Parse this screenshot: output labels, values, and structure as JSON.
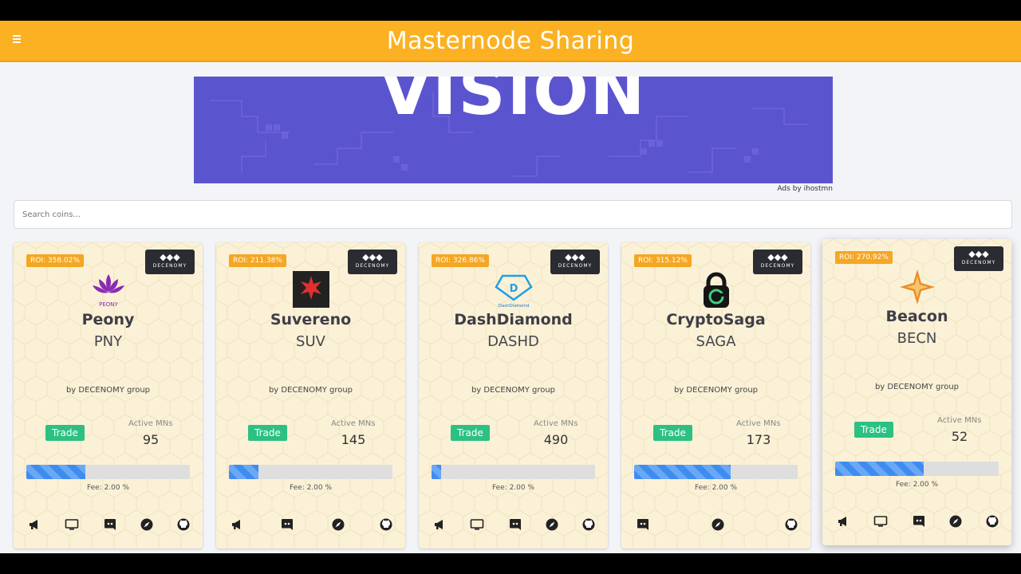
{
  "header": {
    "title": "Masternode Sharing"
  },
  "banner": {
    "text": "VISION",
    "ads_label": "Ads by ihostmn"
  },
  "search": {
    "placeholder": "Search coins..."
  },
  "colors": {
    "header": "#fbb121",
    "roi_badge": "#f5a623",
    "trade_button": "#2cc082",
    "progress": "#3f8cf0",
    "banner": "#5b54cf"
  },
  "cards": [
    {
      "roi": "ROI: 358.02%",
      "group_badge": "DECENOMY",
      "logo_icon": "peony-lotus-icon",
      "logo_text": "PEONY",
      "name": "Peony",
      "ticker": "PNY",
      "by": "by DECENOMY group",
      "trade_label": "Trade",
      "mns_label": "Active MNs",
      "mns": "95",
      "progress": 0.36,
      "fee": "Fee: 2.00 %",
      "links": [
        "announcement-icon",
        "website-icon",
        "discord-icon",
        "explorer-icon",
        "github-icon"
      ]
    },
    {
      "roi": "ROI: 211.38%",
      "group_badge": "DECENOMY",
      "logo_icon": "suvereno-cross-icon",
      "logo_text": "",
      "name": "Suvereno",
      "ticker": "SUV",
      "by": "by DECENOMY group",
      "trade_label": "Trade",
      "mns_label": "Active MNs",
      "mns": "145",
      "progress": 0.18,
      "fee": "Fee: 2.00 %",
      "links": [
        "announcement-icon",
        "discord-icon",
        "explorer-icon",
        "github-icon"
      ]
    },
    {
      "roi": "ROI: 326.86%",
      "group_badge": "DECENOMY",
      "logo_icon": "dashdiamond-icon",
      "logo_text": "DashDiamond",
      "name": "DashDiamond",
      "ticker": "DASHD",
      "by": "by DECENOMY group",
      "trade_label": "Trade",
      "mns_label": "Active MNs",
      "mns": "490",
      "progress": 0.06,
      "fee": "Fee: 2.00 %",
      "links": [
        "announcement-icon",
        "website-icon",
        "discord-icon",
        "explorer-icon",
        "github-icon"
      ]
    },
    {
      "roi": "ROI: 315.12%",
      "group_badge": "DECENOMY",
      "logo_icon": "cryptosaga-lock-icon",
      "logo_text": "",
      "name": "CryptoSaga",
      "ticker": "SAGA",
      "by": "by DECENOMY group",
      "trade_label": "Trade",
      "mns_label": "Active MNs",
      "mns": "173",
      "progress": 0.59,
      "fee": "Fee: 2.00 %",
      "links": [
        "discord-icon",
        "explorer-icon",
        "github-icon"
      ]
    },
    {
      "roi": "ROI: 270.92%",
      "group_badge": "DECENOMY",
      "logo_icon": "beacon-star-icon",
      "logo_text": "",
      "name": "Beacon",
      "ticker": "BECN",
      "by": "by DECENOMY group",
      "trade_label": "Trade",
      "mns_label": "Active MNs",
      "mns": "52",
      "progress": 0.54,
      "fee": "Fee: 2.00 %",
      "links": [
        "announcement-icon",
        "website-icon",
        "discord-icon",
        "explorer-icon",
        "github-icon"
      ]
    }
  ]
}
